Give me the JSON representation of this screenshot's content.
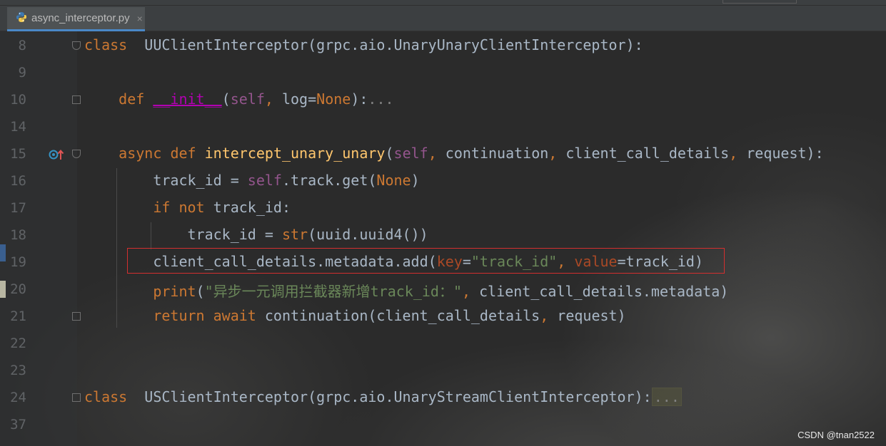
{
  "tab": {
    "filename": "async_interceptor.py",
    "close": "×",
    "icon": "python-file-icon"
  },
  "lines": [
    {
      "num": "8",
      "tokens": [
        [
          "kw",
          "class"
        ],
        [
          "",
          "  UUClientInterceptor(grpc.aio.UnaryUnaryClientInterceptor):"
        ]
      ]
    },
    {
      "num": "9",
      "tokens": []
    },
    {
      "num": "10",
      "tokens": [
        [
          "",
          "    "
        ],
        [
          "kw",
          "def"
        ],
        [
          "",
          " "
        ],
        [
          "dunder",
          "__init__"
        ],
        [
          "",
          "("
        ],
        [
          "self",
          "self"
        ],
        [
          "punct",
          ","
        ],
        [
          "",
          " log="
        ],
        [
          "kw",
          "None"
        ],
        [
          "",
          "):"
        ],
        [
          "fold",
          "..."
        ]
      ]
    },
    {
      "num": "14",
      "tokens": []
    },
    {
      "num": "15",
      "tokens": [
        [
          "",
          "    "
        ],
        [
          "kw",
          "async"
        ],
        [
          "",
          " "
        ],
        [
          "kw",
          "def"
        ],
        [
          "",
          " "
        ],
        [
          "fn",
          "intercept_unary_unary"
        ],
        [
          "",
          "("
        ],
        [
          "self",
          "self"
        ],
        [
          "punct",
          ","
        ],
        [
          "",
          " continuation"
        ],
        [
          "punct",
          ","
        ],
        [
          "",
          " client_call_details"
        ],
        [
          "punct",
          ","
        ],
        [
          "",
          " request):"
        ]
      ]
    },
    {
      "num": "16",
      "tokens": [
        [
          "",
          "        track_id = "
        ],
        [
          "self",
          "self"
        ],
        [
          "",
          ".track.get("
        ],
        [
          "kw",
          "None"
        ],
        [
          "",
          ")"
        ]
      ]
    },
    {
      "num": "17",
      "tokens": [
        [
          "",
          "        "
        ],
        [
          "kw",
          "if"
        ],
        [
          "",
          " "
        ],
        [
          "kw",
          "not"
        ],
        [
          "",
          " track_id:"
        ]
      ]
    },
    {
      "num": "18",
      "tokens": [
        [
          "",
          "            track_id = "
        ],
        [
          "kw",
          "str"
        ],
        [
          "",
          "(uuid.uuid4())"
        ]
      ]
    },
    {
      "num": "19",
      "tokens": [
        [
          "",
          "        client_call_details.metadata.add("
        ],
        [
          "param",
          "key"
        ],
        [
          "",
          "="
        ],
        [
          "str",
          "\"track_id\""
        ],
        [
          "punct",
          ","
        ],
        [
          "",
          " "
        ],
        [
          "param",
          "value"
        ],
        [
          "",
          "=track_id)"
        ]
      ]
    },
    {
      "num": "20",
      "tokens": [
        [
          "",
          "        "
        ],
        [
          "kw",
          "print"
        ],
        [
          "",
          "("
        ],
        [
          "str",
          "\"异步一元调用拦截器新增track_id：\""
        ],
        [
          "punct",
          ","
        ],
        [
          "",
          " client_call_details.metadata)"
        ]
      ]
    },
    {
      "num": "21",
      "tokens": [
        [
          "",
          "        "
        ],
        [
          "kw",
          "return"
        ],
        [
          "",
          " "
        ],
        [
          "kw",
          "await"
        ],
        [
          "",
          " continuation(client_call_details"
        ],
        [
          "punct",
          ","
        ],
        [
          "",
          " request)"
        ]
      ]
    },
    {
      "num": "22",
      "tokens": []
    },
    {
      "num": "23",
      "tokens": []
    },
    {
      "num": "24",
      "tokens": [
        [
          "kw",
          "class"
        ],
        [
          "",
          "  USClientInterceptor(grpc.aio.UnaryStreamClientInterceptor):"
        ],
        [
          "foldbox",
          "..."
        ]
      ]
    },
    {
      "num": "37",
      "tokens": []
    }
  ],
  "gutter_icon": "override-method-up-arrow-icon",
  "watermark": "CSDN @tnan2522",
  "colors": {
    "keyword": "#cc7832",
    "self": "#94558d",
    "function": "#ffc66d",
    "string": "#6a8759",
    "param": "#aa4926",
    "default": "#a9b7c6",
    "highlight_box": "#d32f2f"
  }
}
